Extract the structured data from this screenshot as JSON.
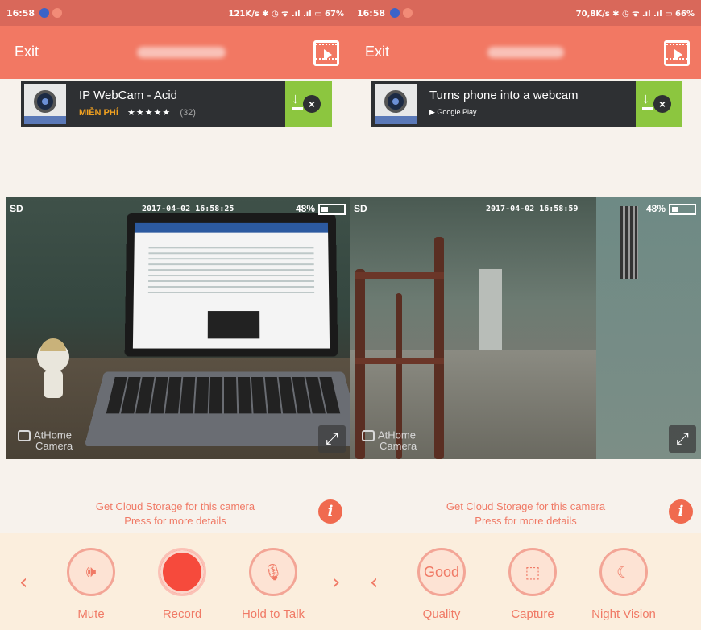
{
  "left": {
    "status": {
      "time": "16:58",
      "right": "121K/s ✱ ◷ ᯤ .ıl .ıl ▭ 67%"
    },
    "appbar": {
      "exit": "Exit"
    },
    "ad": {
      "title": "IP WebCam - Acid",
      "free": "MIỄN PHÍ",
      "stars": "★★★★★",
      "count": "(32)"
    },
    "feed": {
      "quality": "SD",
      "timestamp": "2017-04-02 16:58:25",
      "battery": "48%",
      "logo_line1": "AtHome",
      "logo_line2": "Camera"
    },
    "cloud": {
      "line1": "Get Cloud Storage for this camera",
      "line2": "Press for more details",
      "info": "i"
    },
    "controls": {
      "prev": "‹",
      "next": "›",
      "items": [
        {
          "label": "Mute",
          "icon": "speaker-icon",
          "glyph": "🕪"
        },
        {
          "label": "Record",
          "icon": "record-icon",
          "glyph": ""
        },
        {
          "label": "Hold to Talk",
          "icon": "microphone-icon",
          "glyph": "🎙"
        }
      ]
    }
  },
  "right": {
    "status": {
      "time": "16:58",
      "right": "70,8K/s ✱ ◷ ᯤ .ıl .ıl ▭ 66%"
    },
    "appbar": {
      "exit": "Exit"
    },
    "ad": {
      "title": "Turns phone into a webcam",
      "store": "▶ Google Play"
    },
    "feed": {
      "quality": "SD",
      "timestamp": "2017-04-02 16:58:59",
      "battery": "48%",
      "logo_line1": "AtHome",
      "logo_line2": "Camera"
    },
    "cloud": {
      "line1": "Get Cloud Storage for this camera",
      "line2": "Press for more details",
      "info": "i"
    },
    "controls": {
      "prev": "‹",
      "items": [
        {
          "label": "Quality",
          "icon": "quality-icon",
          "glyph": "Good"
        },
        {
          "label": "Capture",
          "icon": "capture-icon",
          "glyph": "⬚"
        },
        {
          "label": "Night Vision",
          "icon": "night-vision-icon",
          "glyph": "☾"
        }
      ]
    }
  },
  "colors": {
    "statusbar": "#d9685a",
    "appbar": "#f27863",
    "accent": "#f07a66",
    "record": "#f64a3c",
    "ad_green": "#8cc63f"
  }
}
